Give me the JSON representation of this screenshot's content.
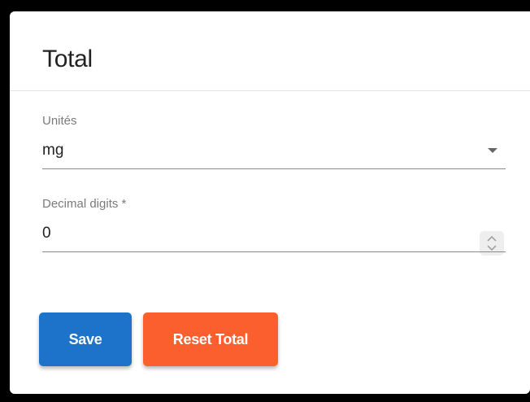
{
  "card": {
    "title": "Total"
  },
  "units_field": {
    "label": "Unités",
    "value": "mg",
    "icon": "dropdown-arrow-icon"
  },
  "decimal_field": {
    "label": "Decimal digits *",
    "value": "0",
    "icon": "stepper-up-down-icon"
  },
  "actions": {
    "save_label": "Save",
    "reset_label": "Reset Total"
  },
  "colors": {
    "save_button": "#1d73c9",
    "reset_button": "#fb5f2d"
  }
}
